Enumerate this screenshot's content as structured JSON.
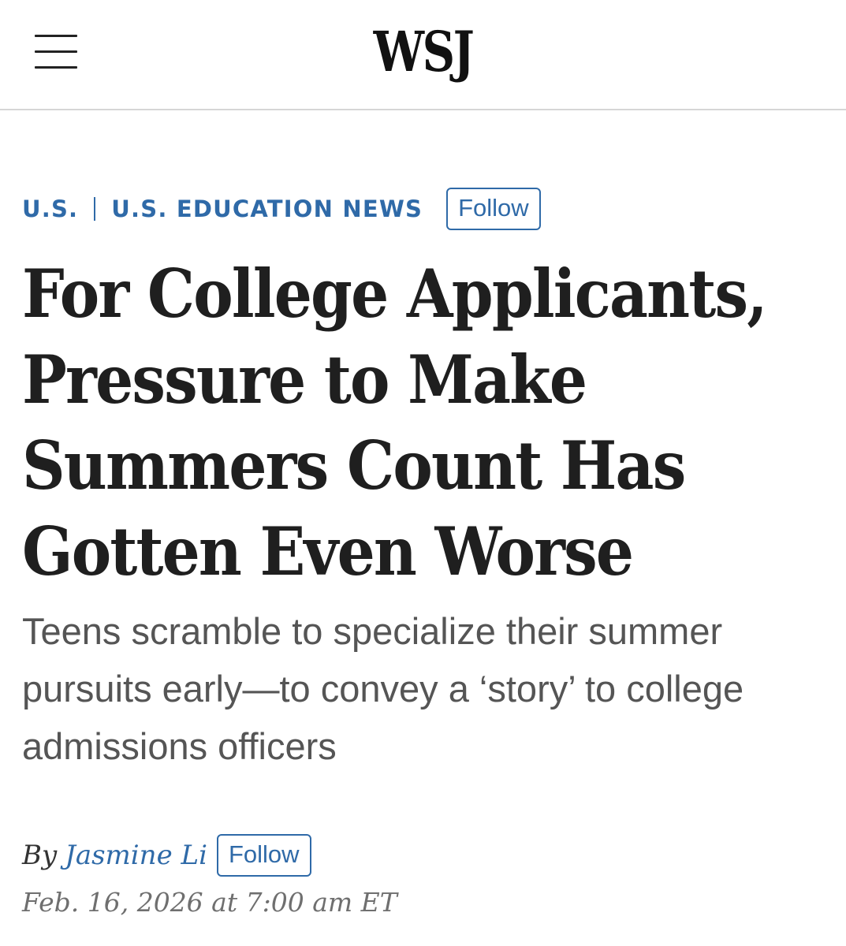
{
  "header": {
    "logo": "WSJ",
    "menu_icon": "hamburger-menu-icon"
  },
  "sections": {
    "primary": "U.S.",
    "secondary": "U.S. EDUCATION NEWS",
    "follow_label": "Follow"
  },
  "article": {
    "headline_lines": [
      "For College Applicants,",
      "Pressure to Make",
      "Summers Count Has",
      "Gotten Even Worse"
    ],
    "dek": "Teens scramble to specialize their summer pursuits early—to convey a ‘story’ to college admissions officers",
    "byline_prefix": "By",
    "author": "Jasmine Li",
    "author_follow_label": "Follow",
    "timestamp": "Feb. 16, 2026 at 7:00 am ET"
  },
  "colors": {
    "accent": "#2f6aa8",
    "headline": "#1f1f1f",
    "dek": "#555555",
    "timestamp": "#6f6f6f",
    "divider": "#d6d6d6"
  }
}
